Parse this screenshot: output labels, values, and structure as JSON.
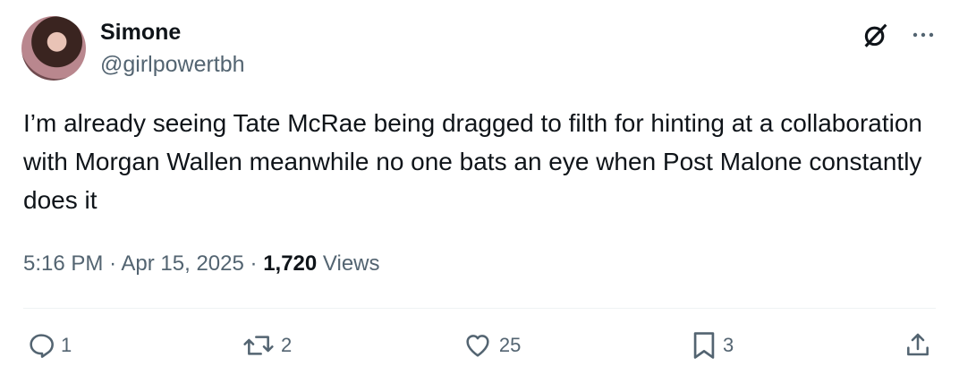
{
  "user": {
    "name": "Simone",
    "handle": "@girlpowertbh"
  },
  "tweet": {
    "text": "I’m already seeing Tate McRae being dragged to filth for hinting at a collaboration with Morgan Wallen meanwhile no one bats an eye when Post Malone constantly does it",
    "time": "5:16 PM",
    "date": "Apr 15, 2025",
    "views_count": "1,720",
    "views_label": "Views",
    "separator": "·"
  },
  "actions": {
    "replies": "1",
    "reposts": "2",
    "likes": "25",
    "bookmarks": "3"
  },
  "icons": {
    "top": [
      "grok-icon",
      "more-icon"
    ],
    "bottom": [
      "reply-icon",
      "repost-icon",
      "like-icon",
      "bookmark-icon",
      "share-icon"
    ]
  },
  "colors": {
    "text": "#0f1419",
    "secondary": "#536471",
    "divider": "#eff3f4"
  }
}
